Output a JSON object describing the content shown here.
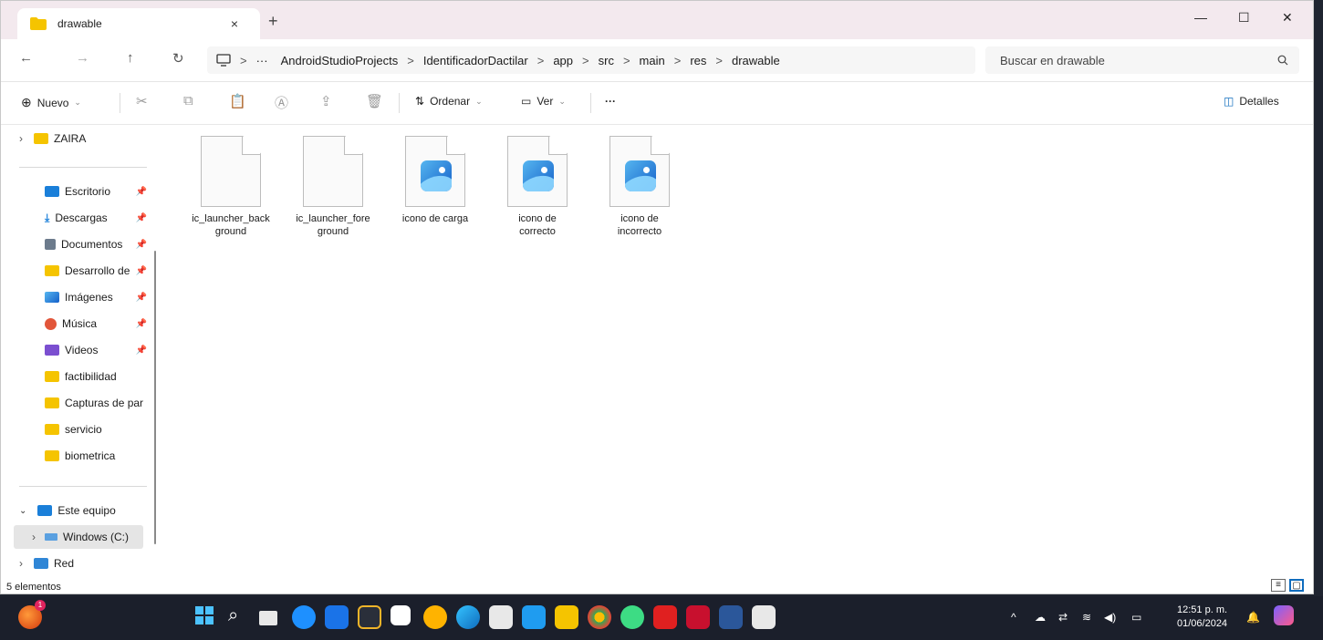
{
  "window": {
    "tab_title": "drawable",
    "tab_close": "×",
    "new_tab": "+",
    "minimize": "—",
    "maximize": "☐",
    "close": "✕"
  },
  "nav": {
    "back": "←",
    "forward": "→",
    "up": "↑",
    "refresh": "↻",
    "more_path": "···",
    "breadcrumb": [
      "AndroidStudioProjects",
      "IdentificadorDactilar",
      "app",
      "src",
      "main",
      "res",
      "drawable"
    ],
    "breadcrumb_sep": ">",
    "search_placeholder": "Buscar en drawable"
  },
  "toolbar": {
    "new_label": "Nuevo",
    "sort_label": "Ordenar",
    "view_label": "Ver",
    "more_label": "···",
    "details_label": "Detalles"
  },
  "sidebar": {
    "top_item": "ZAIRA",
    "quick_access": [
      {
        "label": "Escritorio",
        "pinned": true,
        "icon": "desktop-icon"
      },
      {
        "label": "Descargas",
        "pinned": true,
        "icon": "download-icon"
      },
      {
        "label": "Documentos",
        "pinned": true,
        "icon": "documents-icon"
      },
      {
        "label": "Desarrollo de",
        "pinned": true,
        "icon": "folder-icon"
      },
      {
        "label": "Imágenes",
        "pinned": true,
        "icon": "pictures-icon"
      },
      {
        "label": "Música",
        "pinned": true,
        "icon": "music-icon"
      },
      {
        "label": "Videos",
        "pinned": true,
        "icon": "videos-icon"
      },
      {
        "label": "factibilidad",
        "pinned": false,
        "icon": "folder-icon"
      },
      {
        "label": "Capturas de par",
        "pinned": false,
        "icon": "folder-icon"
      },
      {
        "label": "servicio",
        "pinned": false,
        "icon": "folder-icon"
      },
      {
        "label": "biometrica",
        "pinned": false,
        "icon": "folder-icon"
      }
    ],
    "this_pc": "Este equipo",
    "drive_c": "Windows (C:)",
    "network": "Red"
  },
  "files": [
    {
      "name": "ic_launcher_back ground",
      "type": "blank"
    },
    {
      "name": "ic_launcher_fore ground",
      "type": "blank"
    },
    {
      "name": "icono de carga",
      "type": "image"
    },
    {
      "name": "icono de correcto",
      "type": "image"
    },
    {
      "name": "icono de incorrecto",
      "type": "image"
    }
  ],
  "status": {
    "count": "5 elementos"
  },
  "taskbar": {
    "time": "12:51 p. m.",
    "date": "01/06/2024",
    "notification_badge": "1"
  },
  "colors": {
    "titlebar_bg": "#f3e9ee",
    "folder_yellow": "#f5c400",
    "accent_blue": "#0f6cbd",
    "taskbar_bg": "#1b1f2b"
  }
}
